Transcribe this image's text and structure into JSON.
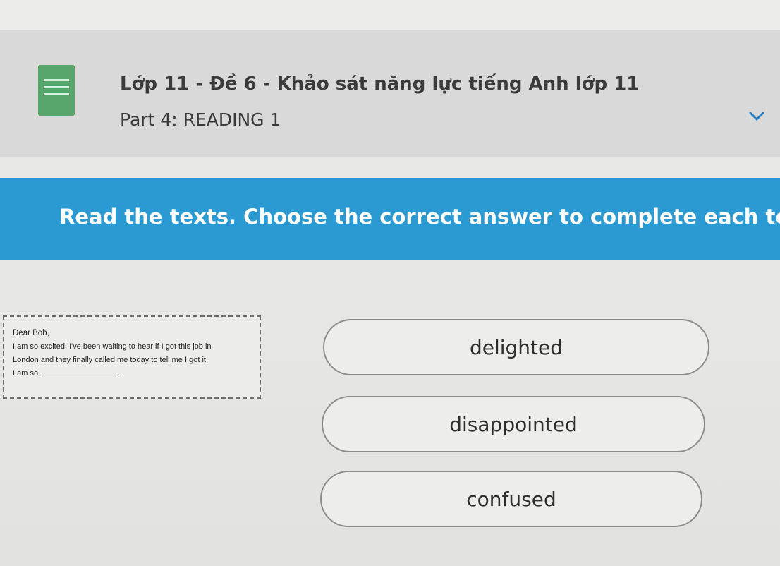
{
  "quiz": {
    "title": "Lớp 11 - Đề 6 - Khảo sát năng lực tiếng Anh lớp 11",
    "part": "Part 4: READING 1"
  },
  "instruction": "Read the texts. Choose the correct answer to complete each text.",
  "letter": {
    "greeting": "Dear Bob,",
    "line1": "I am so excited! I've been waiting to hear if I got this job in",
    "line2": "London and they finally called me today to tell me I got it!",
    "prompt": "I am so",
    "end": "."
  },
  "options": [
    {
      "label": "delighted"
    },
    {
      "label": "disappointed"
    },
    {
      "label": "confused"
    }
  ],
  "icons": {
    "document": "document-icon",
    "expand": "chevron-down-icon"
  },
  "colors": {
    "banner": "#2b9ad3",
    "doc_icon": "#58a56c"
  }
}
